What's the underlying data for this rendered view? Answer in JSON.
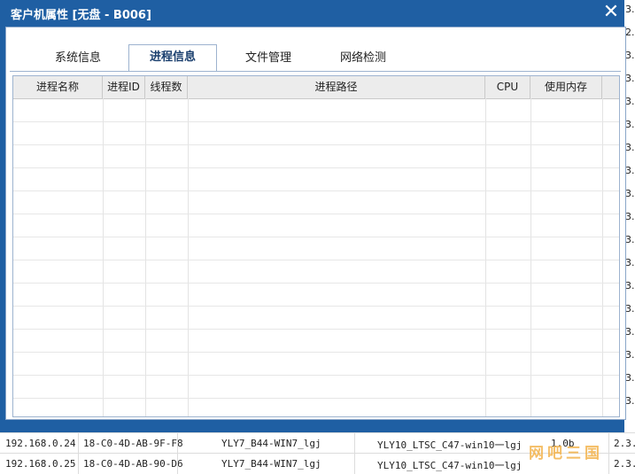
{
  "dialog": {
    "title": "客户机属性 [无盘 - B006]",
    "close_glyph": "✕",
    "tabs": [
      {
        "label": "系统信息",
        "active": false
      },
      {
        "label": "进程信息",
        "active": true
      },
      {
        "label": "文件管理",
        "active": false
      },
      {
        "label": "网络检测",
        "active": false
      }
    ],
    "process_table": {
      "columns": [
        "进程名称",
        "进程ID",
        "线程数",
        "进程路径",
        "CPU",
        "使用内存"
      ],
      "rows": []
    }
  },
  "background_table": {
    "right_column_values": [
      "3.",
      "2.",
      "3.",
      "3.",
      "3.",
      "3.",
      "3.",
      "3.",
      "3.",
      "3.",
      "3.",
      "3.",
      "3.",
      "3.",
      "3.",
      "3.",
      "3.",
      "3."
    ],
    "rows": [
      {
        "ip": "192.168.0.24",
        "mac": "18-C0-4D-AB-9F-F8",
        "image": "YLY7_B44-WIN7_lgj",
        "config": "YLY10_LTSC_C47-win10一lgj",
        "extra": "1.0b",
        "version": "2.3."
      },
      {
        "ip": "192.168.0.25",
        "mac": "18-C0-4D-AB-90-D6",
        "image": "YLY7_B44-WIN7_lgj",
        "config": "YLY10_LTSC_C47-win10一lgj",
        "extra": "",
        "version": "2.3."
      }
    ]
  },
  "watermark": "网吧三国"
}
